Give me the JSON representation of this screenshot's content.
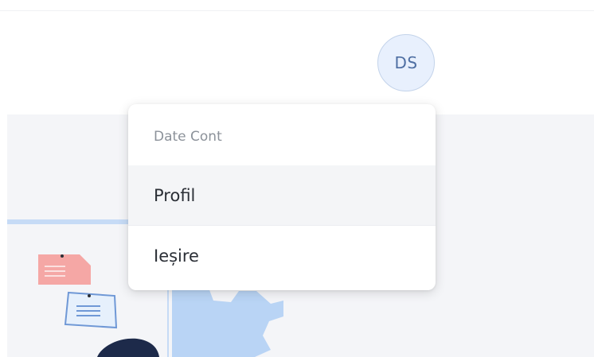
{
  "header": {
    "avatar_initials": "DS"
  },
  "account_menu": {
    "header_label": "Date Cont",
    "items": [
      {
        "label": "Profil",
        "highlighted": true
      },
      {
        "label": "Ieșire",
        "highlighted": false
      }
    ]
  },
  "colors": {
    "avatar_bg": "#e8f0fd",
    "avatar_text": "#4f6fa3",
    "illustration_blue": "#b9d4f5",
    "illustration_red": "#f5a7a5",
    "illustration_navy": "#1d2a4a"
  }
}
